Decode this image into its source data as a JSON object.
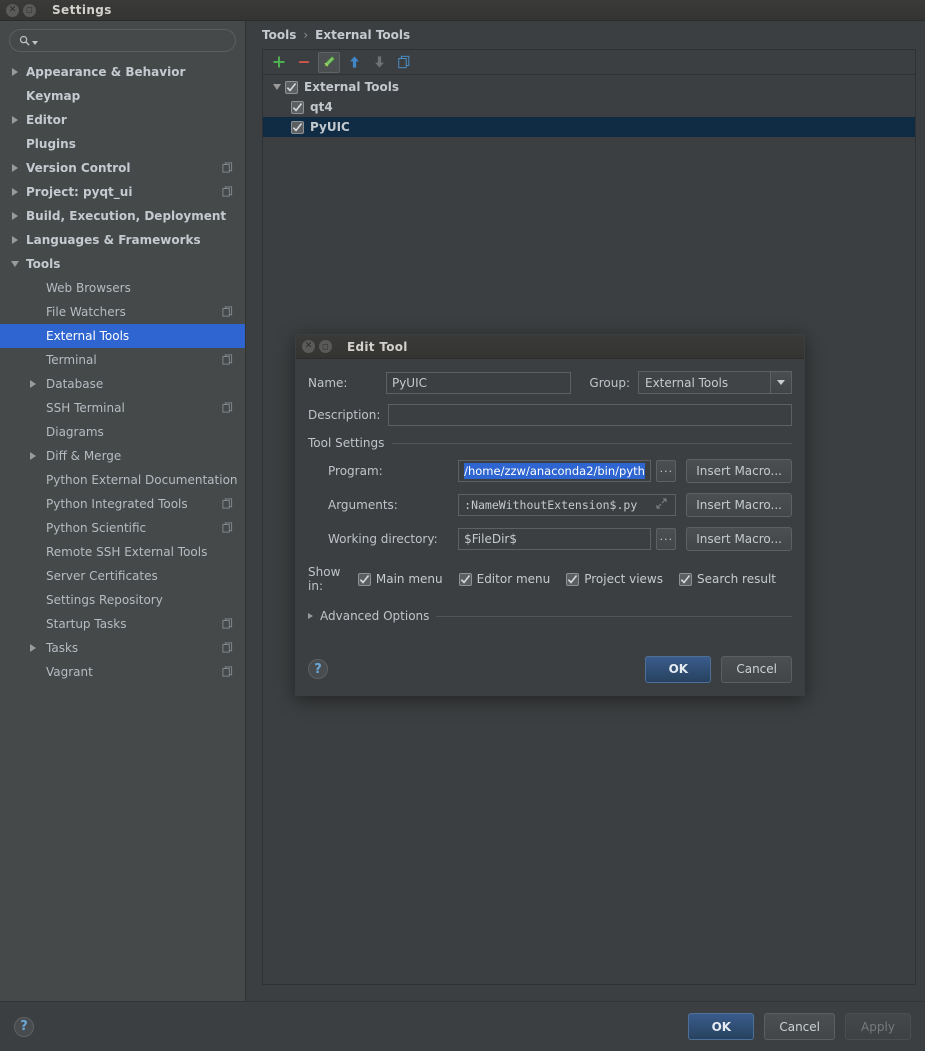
{
  "window": {
    "title": "Settings",
    "close_icon": "close-icon",
    "maximize_icon": "maximize-icon"
  },
  "search": {
    "value": "",
    "placeholder": "",
    "icon": "search-icon"
  },
  "sidebar": {
    "items": [
      {
        "label": "Appearance & Behavior",
        "level": 0,
        "bold": true,
        "arrow": "right",
        "copy": false,
        "selected": false
      },
      {
        "label": "Keymap",
        "level": 0,
        "bold": true,
        "arrow": "none",
        "copy": false,
        "selected": false
      },
      {
        "label": "Editor",
        "level": 0,
        "bold": true,
        "arrow": "right",
        "copy": false,
        "selected": false
      },
      {
        "label": "Plugins",
        "level": 0,
        "bold": true,
        "arrow": "none",
        "copy": false,
        "selected": false
      },
      {
        "label": "Version Control",
        "level": 0,
        "bold": true,
        "arrow": "right",
        "copy": true,
        "selected": false
      },
      {
        "label": "Project: pyqt_ui",
        "level": 0,
        "bold": true,
        "arrow": "right",
        "copy": true,
        "selected": false
      },
      {
        "label": "Build, Execution, Deployment",
        "level": 0,
        "bold": true,
        "arrow": "right",
        "copy": false,
        "selected": false
      },
      {
        "label": "Languages & Frameworks",
        "level": 0,
        "bold": true,
        "arrow": "right",
        "copy": false,
        "selected": false
      },
      {
        "label": "Tools",
        "level": 0,
        "bold": true,
        "arrow": "down",
        "copy": false,
        "selected": false
      },
      {
        "label": "Web Browsers",
        "level": 1,
        "bold": false,
        "arrow": "none",
        "copy": false,
        "selected": false
      },
      {
        "label": "File Watchers",
        "level": 1,
        "bold": false,
        "arrow": "none",
        "copy": true,
        "selected": false
      },
      {
        "label": "External Tools",
        "level": 1,
        "bold": false,
        "arrow": "none",
        "copy": false,
        "selected": true
      },
      {
        "label": "Terminal",
        "level": 1,
        "bold": false,
        "arrow": "none",
        "copy": true,
        "selected": false
      },
      {
        "label": "Database",
        "level": 1,
        "bold": false,
        "arrow": "right",
        "copy": false,
        "selected": false
      },
      {
        "label": "SSH Terminal",
        "level": 1,
        "bold": false,
        "arrow": "none",
        "copy": true,
        "selected": false
      },
      {
        "label": "Diagrams",
        "level": 1,
        "bold": false,
        "arrow": "none",
        "copy": false,
        "selected": false
      },
      {
        "label": "Diff & Merge",
        "level": 1,
        "bold": false,
        "arrow": "right",
        "copy": false,
        "selected": false
      },
      {
        "label": "Python External Documentation",
        "level": 1,
        "bold": false,
        "arrow": "none",
        "copy": false,
        "selected": false
      },
      {
        "label": "Python Integrated Tools",
        "level": 1,
        "bold": false,
        "arrow": "none",
        "copy": true,
        "selected": false
      },
      {
        "label": "Python Scientific",
        "level": 1,
        "bold": false,
        "arrow": "none",
        "copy": true,
        "selected": false
      },
      {
        "label": "Remote SSH External Tools",
        "level": 1,
        "bold": false,
        "arrow": "none",
        "copy": false,
        "selected": false
      },
      {
        "label": "Server Certificates",
        "level": 1,
        "bold": false,
        "arrow": "none",
        "copy": false,
        "selected": false
      },
      {
        "label": "Settings Repository",
        "level": 1,
        "bold": false,
        "arrow": "none",
        "copy": false,
        "selected": false
      },
      {
        "label": "Startup Tasks",
        "level": 1,
        "bold": false,
        "arrow": "none",
        "copy": true,
        "selected": false
      },
      {
        "label": "Tasks",
        "level": 1,
        "bold": false,
        "arrow": "right",
        "copy": true,
        "selected": false
      },
      {
        "label": "Vagrant",
        "level": 1,
        "bold": false,
        "arrow": "none",
        "copy": true,
        "selected": false
      }
    ]
  },
  "breadcrumb": {
    "root": "Tools",
    "separator": "›",
    "current": "External Tools"
  },
  "toolbar": {
    "buttons": [
      {
        "name": "add-button",
        "icon": "plus-icon",
        "active": false
      },
      {
        "name": "remove-button",
        "icon": "minus-icon",
        "active": false
      },
      {
        "name": "edit-button",
        "icon": "pencil-icon",
        "active": true
      },
      {
        "name": "move-up-button",
        "icon": "arrow-up-icon",
        "active": false
      },
      {
        "name": "move-down-button",
        "icon": "arrow-down-icon",
        "active": false
      },
      {
        "name": "copy-button",
        "icon": "copy-icon",
        "active": false
      }
    ]
  },
  "tool_tree": {
    "rows": [
      {
        "label": "External Tools",
        "level": 0,
        "checked": true,
        "expanded": true,
        "highlighted": false
      },
      {
        "label": "qt4",
        "level": 1,
        "checked": true,
        "expanded": null,
        "highlighted": false
      },
      {
        "label": "PyUIC",
        "level": 1,
        "checked": true,
        "expanded": null,
        "highlighted": true
      }
    ]
  },
  "dialog": {
    "title": "Edit Tool",
    "close_icon": "close-icon",
    "maximize_icon": "maximize-icon",
    "name_label": "Name:",
    "name_value": "PyUIC",
    "group_label": "Group:",
    "group_value": "External Tools",
    "description_label": "Description:",
    "description_value": "",
    "tool_settings_label": "Tool Settings",
    "program_label": "Program:",
    "program_value": "/home/zzw/anaconda2/bin/pyth",
    "arguments_label": "Arguments:",
    "arguments_value": ":NameWithoutExtension$.py",
    "working_directory_label": "Working directory:",
    "working_directory_value": "$FileDir$",
    "browse_label": "...",
    "insert_macro_label": "Insert Macro...",
    "show_in_label": "Show in:",
    "show_in_options": [
      {
        "label": "Main menu",
        "checked": true
      },
      {
        "label": "Editor menu",
        "checked": true
      },
      {
        "label": "Project views",
        "checked": true
      },
      {
        "label": "Search result",
        "checked": true
      }
    ],
    "advanced_options_label": "Advanced Options",
    "help_label": "?",
    "ok_label": "OK",
    "cancel_label": "Cancel"
  },
  "footer": {
    "help_label": "?",
    "ok_label": "OK",
    "cancel_label": "Cancel",
    "apply_label": "Apply"
  },
  "colors": {
    "selection_blue": "#2f65d0",
    "tree_highlight": "#0f2c44",
    "window_bg": "#3c3f41",
    "sidebar_bg": "#45494a",
    "accent_green": "#4caf50",
    "accent_red": "#d4564a",
    "accent_blue": "#3e87c8",
    "primary_button": "#27425f"
  }
}
